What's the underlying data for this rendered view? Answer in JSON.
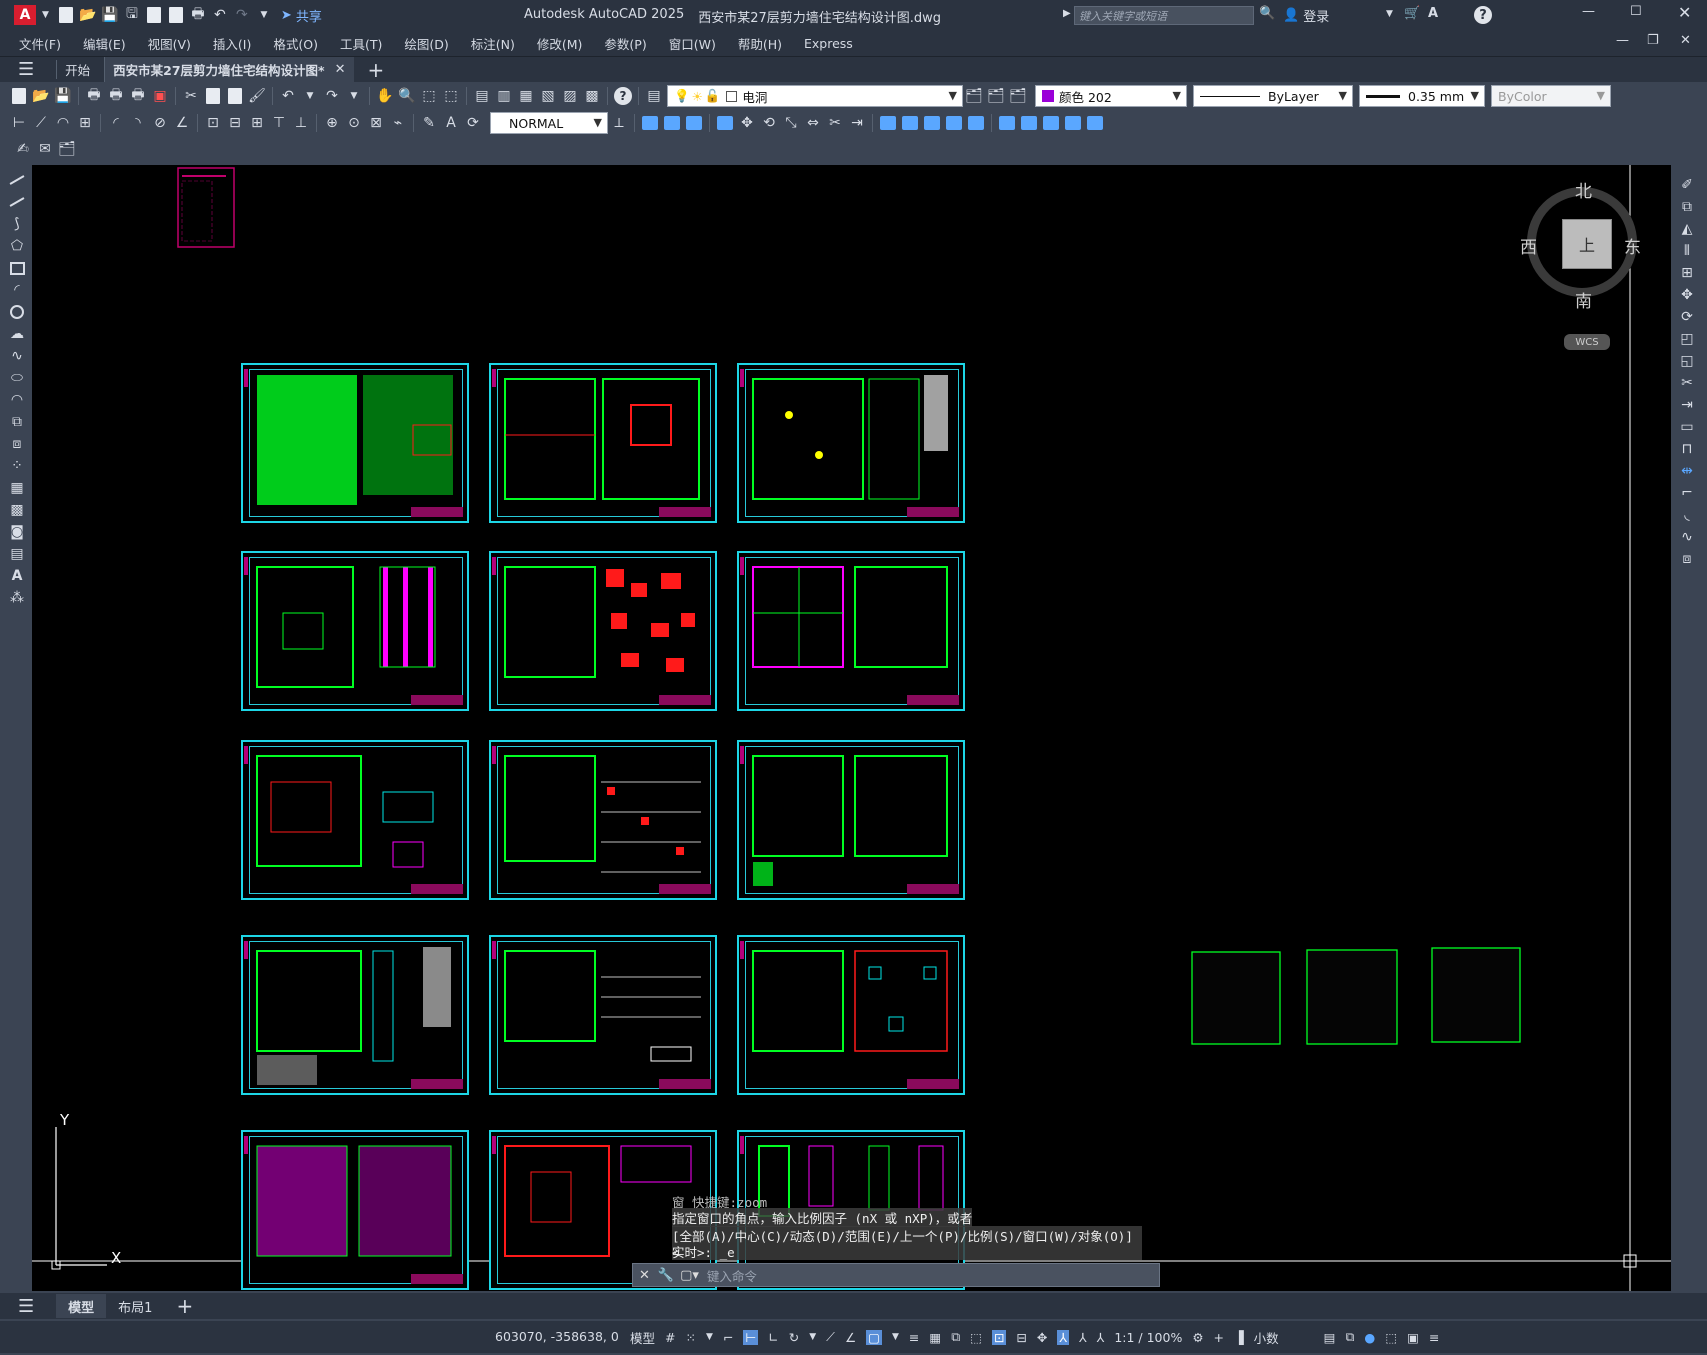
{
  "window": {
    "app_title": "Autodesk AutoCAD 2025",
    "file_title": "西安市某27层剪力墙住宅结构设计图.dwg",
    "search_placeholder": "键入关键字或短语",
    "login": "登录",
    "share": "共享"
  },
  "menu": [
    "文件(F)",
    "编辑(E)",
    "视图(V)",
    "插入(I)",
    "格式(O)",
    "工具(T)",
    "绘图(D)",
    "标注(N)",
    "修改(M)",
    "参数(P)",
    "窗口(W)",
    "帮助(H)",
    "Express"
  ],
  "tabs": {
    "start": "开始",
    "active": "西安市某27层剪力墙住宅结构设计图*",
    "add": "+"
  },
  "properties": {
    "layer": "电洞",
    "color": "颜色 202",
    "color_swatch": "#9a00d8",
    "linetype": "ByLayer",
    "lineweight": "0.35 mm",
    "plotstyle": "ByColor",
    "dimstyle": "NORMAL"
  },
  "viewcube": {
    "north": "北",
    "south": "南",
    "east": "东",
    "west": "西",
    "face": "上",
    "wcs": "WCS"
  },
  "ucs": {
    "x": "X",
    "y": "Y"
  },
  "command": {
    "history": [
      "窗 快捷键:zoom",
      "指定窗口的角点，输入比例因子 (nX 或 nXP)，或者",
      "[全部(A)/中心(C)/动态(D)/范围(E)/上一个(P)/比例(S)/窗口(W)/对象(O)] <",
      "实时>: _e"
    ],
    "placeholder": "键入命令"
  },
  "layout_tabs": [
    "模型",
    "布局1"
  ],
  "status": {
    "coords": "603070, -358638, 0",
    "model": "模型",
    "scale": "1:1 / 100%",
    "units": "小数"
  },
  "colors": {
    "sheet_border": "#1dd6e6",
    "drawing_green": "#00ff22",
    "drawing_red": "#ff1a1a",
    "drawing_magenta": "#ff00ff",
    "background": "#000000"
  }
}
